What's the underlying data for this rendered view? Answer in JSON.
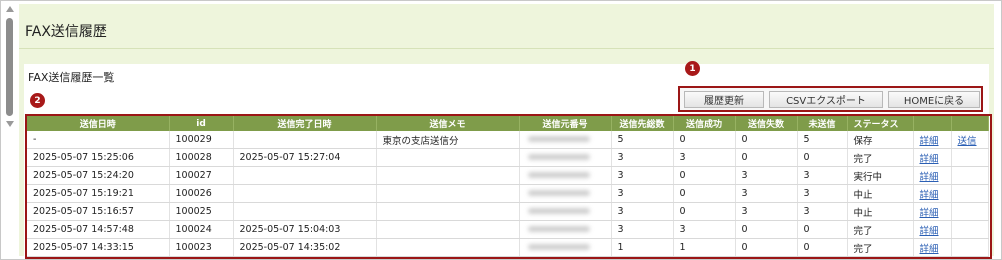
{
  "page": {
    "title": "FAX送信履歴",
    "subtitle": "FAX送信履歴一覧"
  },
  "buttons": {
    "history_update": "履歴更新",
    "csv_export": "CSVエクスポート",
    "home_return": "HOMEに戻る"
  },
  "badges": {
    "one": "1",
    "two": "2"
  },
  "table": {
    "headers": [
      "送信日時",
      "id",
      "送信完了日時",
      "送信メモ",
      "送信元番号",
      "送信先総数",
      "送信成功",
      "送信失数",
      "未送信",
      "ステータス"
    ],
    "rows": [
      {
        "sent": "-",
        "id": "100029",
        "done": "",
        "memo": "東京の支店送信分",
        "src": "",
        "total": "5",
        "ok": "0",
        "fail": "0",
        "unsent": "5",
        "status": "保存",
        "detail": "詳細",
        "send": "送信"
      },
      {
        "sent": "2025-05-07 15:25:06",
        "id": "100028",
        "done": "2025-05-07 15:27:04",
        "memo": "",
        "src": "",
        "total": "3",
        "ok": "3",
        "fail": "0",
        "unsent": "0",
        "status": "完了",
        "detail": "詳細",
        "send": ""
      },
      {
        "sent": "2025-05-07 15:24:20",
        "id": "100027",
        "done": "",
        "memo": "",
        "src": "",
        "total": "3",
        "ok": "0",
        "fail": "3",
        "unsent": "3",
        "status": "実行中",
        "detail": "詳細",
        "send": ""
      },
      {
        "sent": "2025-05-07 15:19:21",
        "id": "100026",
        "done": "",
        "memo": "",
        "src": "",
        "total": "3",
        "ok": "0",
        "fail": "3",
        "unsent": "3",
        "status": "中止",
        "detail": "詳細",
        "send": ""
      },
      {
        "sent": "2025-05-07 15:16:57",
        "id": "100025",
        "done": "",
        "memo": "",
        "src": "",
        "total": "3",
        "ok": "0",
        "fail": "3",
        "unsent": "3",
        "status": "中止",
        "detail": "詳細",
        "send": ""
      },
      {
        "sent": "2025-05-07 14:57:48",
        "id": "100024",
        "done": "2025-05-07 15:04:03",
        "memo": "",
        "src": "",
        "total": "3",
        "ok": "3",
        "fail": "0",
        "unsent": "0",
        "status": "完了",
        "detail": "詳細",
        "send": ""
      },
      {
        "sent": "2025-05-07 14:33:15",
        "id": "100023",
        "done": "2025-05-07 14:35:02",
        "memo": "",
        "src": "",
        "total": "1",
        "ok": "1",
        "fail": "0",
        "unsent": "0",
        "status": "完了",
        "detail": "詳細",
        "send": ""
      }
    ]
  },
  "colors": {
    "header_green": "#7f9c4a",
    "panel_green": "#eef5dc",
    "highlight_red": "#9b1616",
    "link_blue": "#2b5fb4"
  }
}
